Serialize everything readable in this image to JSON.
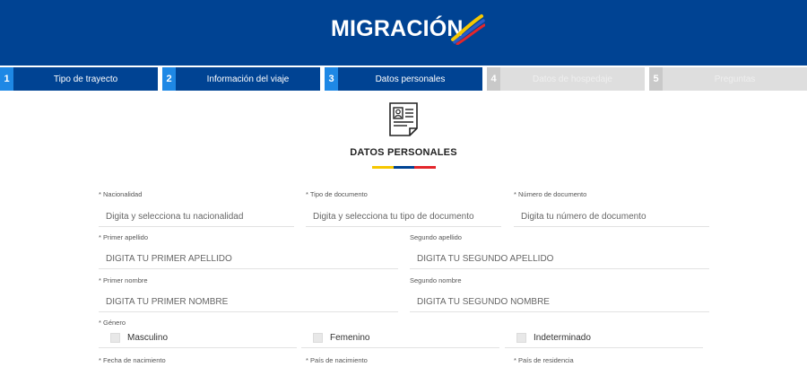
{
  "header": {
    "logo_text": "MIGRACIÓN"
  },
  "steps": [
    {
      "num": "1",
      "label": "Tipo de trayecto",
      "state": "active"
    },
    {
      "num": "2",
      "label": "Información del viaje",
      "state": "active"
    },
    {
      "num": "3",
      "label": "Datos personales",
      "state": "active"
    },
    {
      "num": "4",
      "label": "Datos de hospedaje",
      "state": "inactive"
    },
    {
      "num": "5",
      "label": "Preguntas",
      "state": "inactive"
    }
  ],
  "section": {
    "title": "DATOS PERSONALES",
    "icon": "personal-document-icon"
  },
  "fields": {
    "nacionalidad": {
      "label": "* Nacionalidad",
      "placeholder": "Digita y selecciona tu nacionalidad"
    },
    "tipo_documento": {
      "label": "* Tipo de documento",
      "placeholder": "Digita y selecciona tu tipo de documento"
    },
    "numero_documento": {
      "label": "* Número de documento",
      "placeholder": "Digita tu número de documento"
    },
    "primer_apellido": {
      "label": "* Primer apellido",
      "placeholder": "DIGITA TU PRIMER APELLIDO"
    },
    "segundo_apellido": {
      "label": "Segundo apellido",
      "placeholder": "DIGITA TU SEGUNDO APELLIDO"
    },
    "primer_nombre": {
      "label": "* Primer nombre",
      "placeholder": "DIGITA TU PRIMER NOMBRE"
    },
    "segundo_nombre": {
      "label": "Segundo nombre",
      "placeholder": "DIGITA TU SEGUNDO NOMBRE"
    },
    "genero": {
      "label": "* Género",
      "options": [
        "Masculino",
        "Femenino",
        "Indeterminado"
      ]
    },
    "fecha_nacimiento": {
      "label": "* Fecha de nacimiento"
    },
    "pais_nacimiento": {
      "label": "* País de nacimiento"
    },
    "pais_residencia": {
      "label": "* País de residencia"
    }
  },
  "colors": {
    "brand_blue": "#004393",
    "accent_blue": "#1e88e5",
    "flag_yellow": "#f6c700",
    "flag_blue": "#004393",
    "flag_red": "#e3262b"
  }
}
